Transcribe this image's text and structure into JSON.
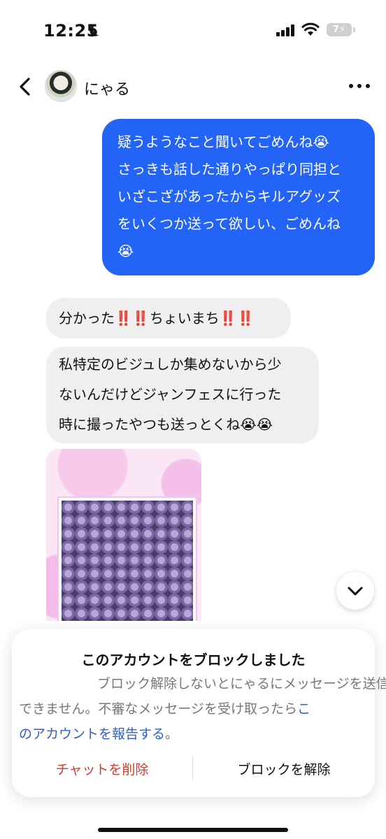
{
  "status_bar": {
    "time": "12:25",
    "battery": "7"
  },
  "header": {
    "contact_name": "にゃる"
  },
  "messages": {
    "outgoing_1": [
      "疑うようなこと聞いてごめんね😭",
      "さっきも話した通りやっぱり同担と",
      "いざこざがあったからキルアグッズ",
      "をいくつか送って欲しい、ごめんね",
      "😭"
    ],
    "incoming_1": {
      "part1": "分かった",
      "excl1": "‼️‼️",
      "part2": "ちょいまち",
      "excl2": "‼️‼️"
    },
    "incoming_2": [
      "私特定のビジュしか集めないから少",
      "ないんだけどジャンフェスに行った",
      "時に撮ったやつも送っとくね😭😭"
    ]
  },
  "block_panel": {
    "title": "このアカウントをブロックしました",
    "text_line1": "ブロック解除しないとにゃるにメッセージを送信",
    "text_line2_plain": "できません。不審なメッセージを受け取ったら",
    "text_line2_link": "こ",
    "text_line3_link": "のアカウントを報告する",
    "text_line3_plain": "。",
    "delete_chat": "チャットを削除",
    "unblock": "ブロックを解除"
  },
  "colors": {
    "outgoing_bubble": "#2363f5",
    "incoming_bubble": "#efefef",
    "link": "#2f5fc7",
    "danger": "#d33b2c"
  }
}
